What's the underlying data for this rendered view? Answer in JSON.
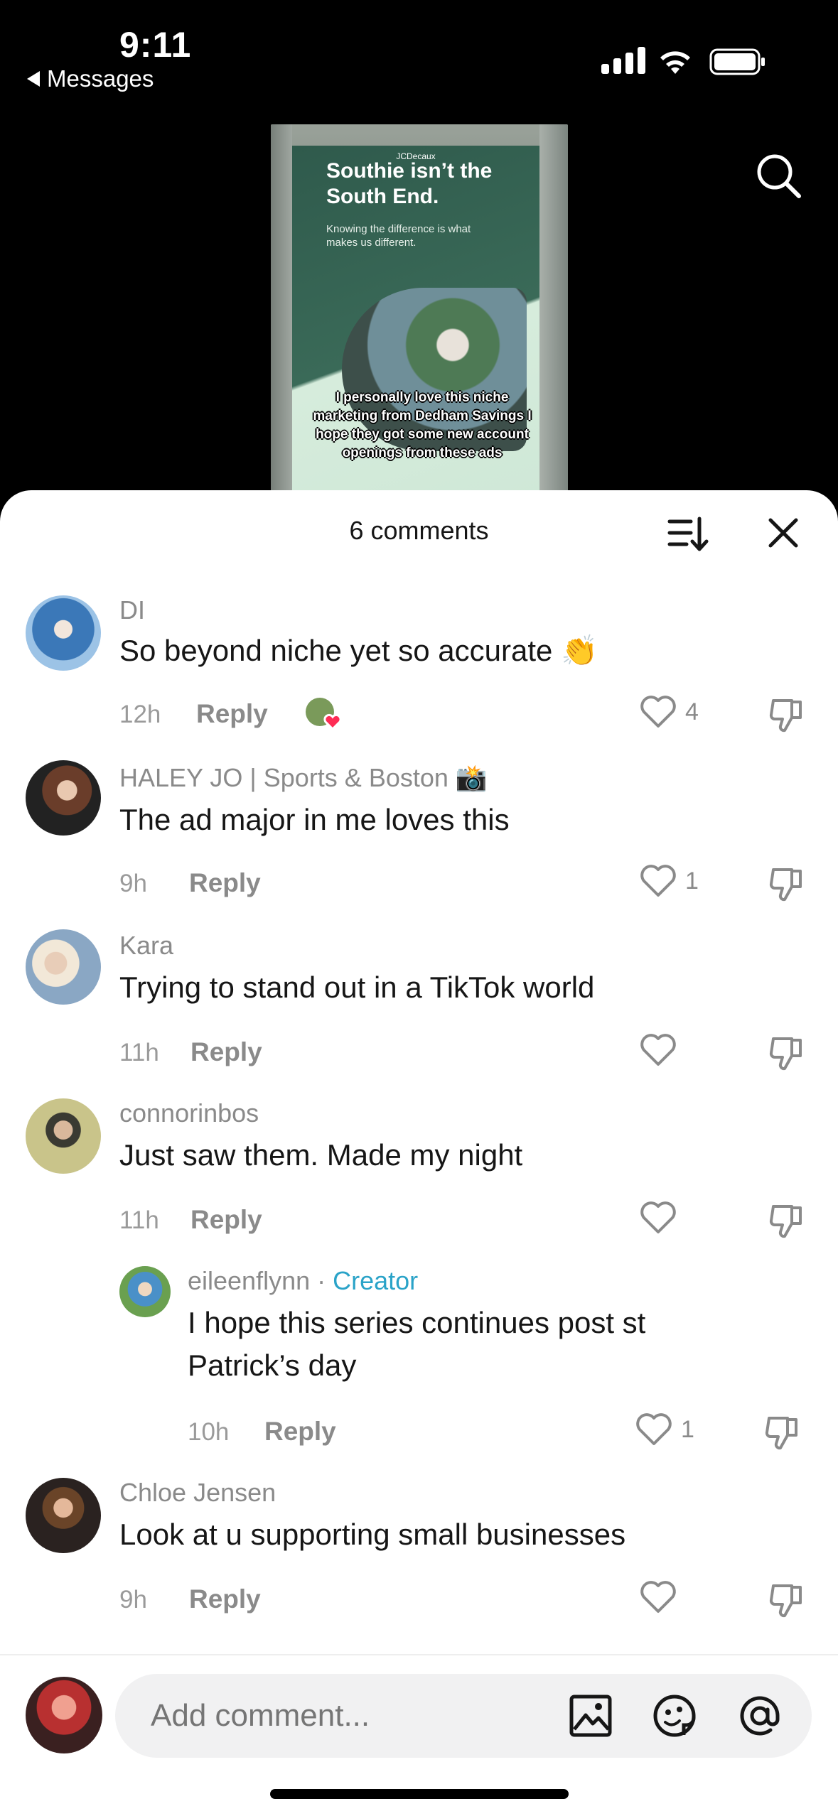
{
  "status_bar": {
    "time": "9:11",
    "back_label": "Messages"
  },
  "video": {
    "ad_brand": "JCDecaux",
    "ad_headline": "Southie isn’t the South End.",
    "ad_subline": "Knowing the difference is what makes us different.",
    "caption": "I personally love this niche marketing from Dedham Savings I hope they got some new account openings from these ads"
  },
  "sheet": {
    "title": "6 comments"
  },
  "comments": [
    {
      "user": "DI",
      "text": "So beyond niche yet so accurate 👏",
      "time": "12h",
      "reply": "Reply",
      "likes": "4"
    },
    {
      "user": "HALEY JO | Sports & Boston 📸",
      "text": "The ad major in me loves this",
      "time": "9h",
      "reply": "Reply",
      "likes": "1"
    },
    {
      "user": "Kara",
      "text": "Trying to stand out in a TikTok world",
      "time": "11h",
      "reply": "Reply",
      "likes": ""
    },
    {
      "user": "connorinbos",
      "text": "Just saw them. Made my night",
      "time": "11h",
      "reply": "Reply",
      "likes": ""
    },
    {
      "user": "eileenflynn",
      "separator": " · ",
      "badge": "Creator",
      "text": "I hope this series continues post st Patrick’s day",
      "time": "10h",
      "reply": "Reply",
      "likes": "1"
    },
    {
      "user": "Chloe Jensen",
      "text": "Look at u supporting small businesses",
      "time": "9h",
      "reply": "Reply",
      "likes": ""
    }
  ],
  "composer": {
    "placeholder": "Add comment..."
  },
  "colors": {
    "creator": "#2aa3c8",
    "like_heart": "#fe2c55",
    "sheet_bg": "#ffffff"
  }
}
